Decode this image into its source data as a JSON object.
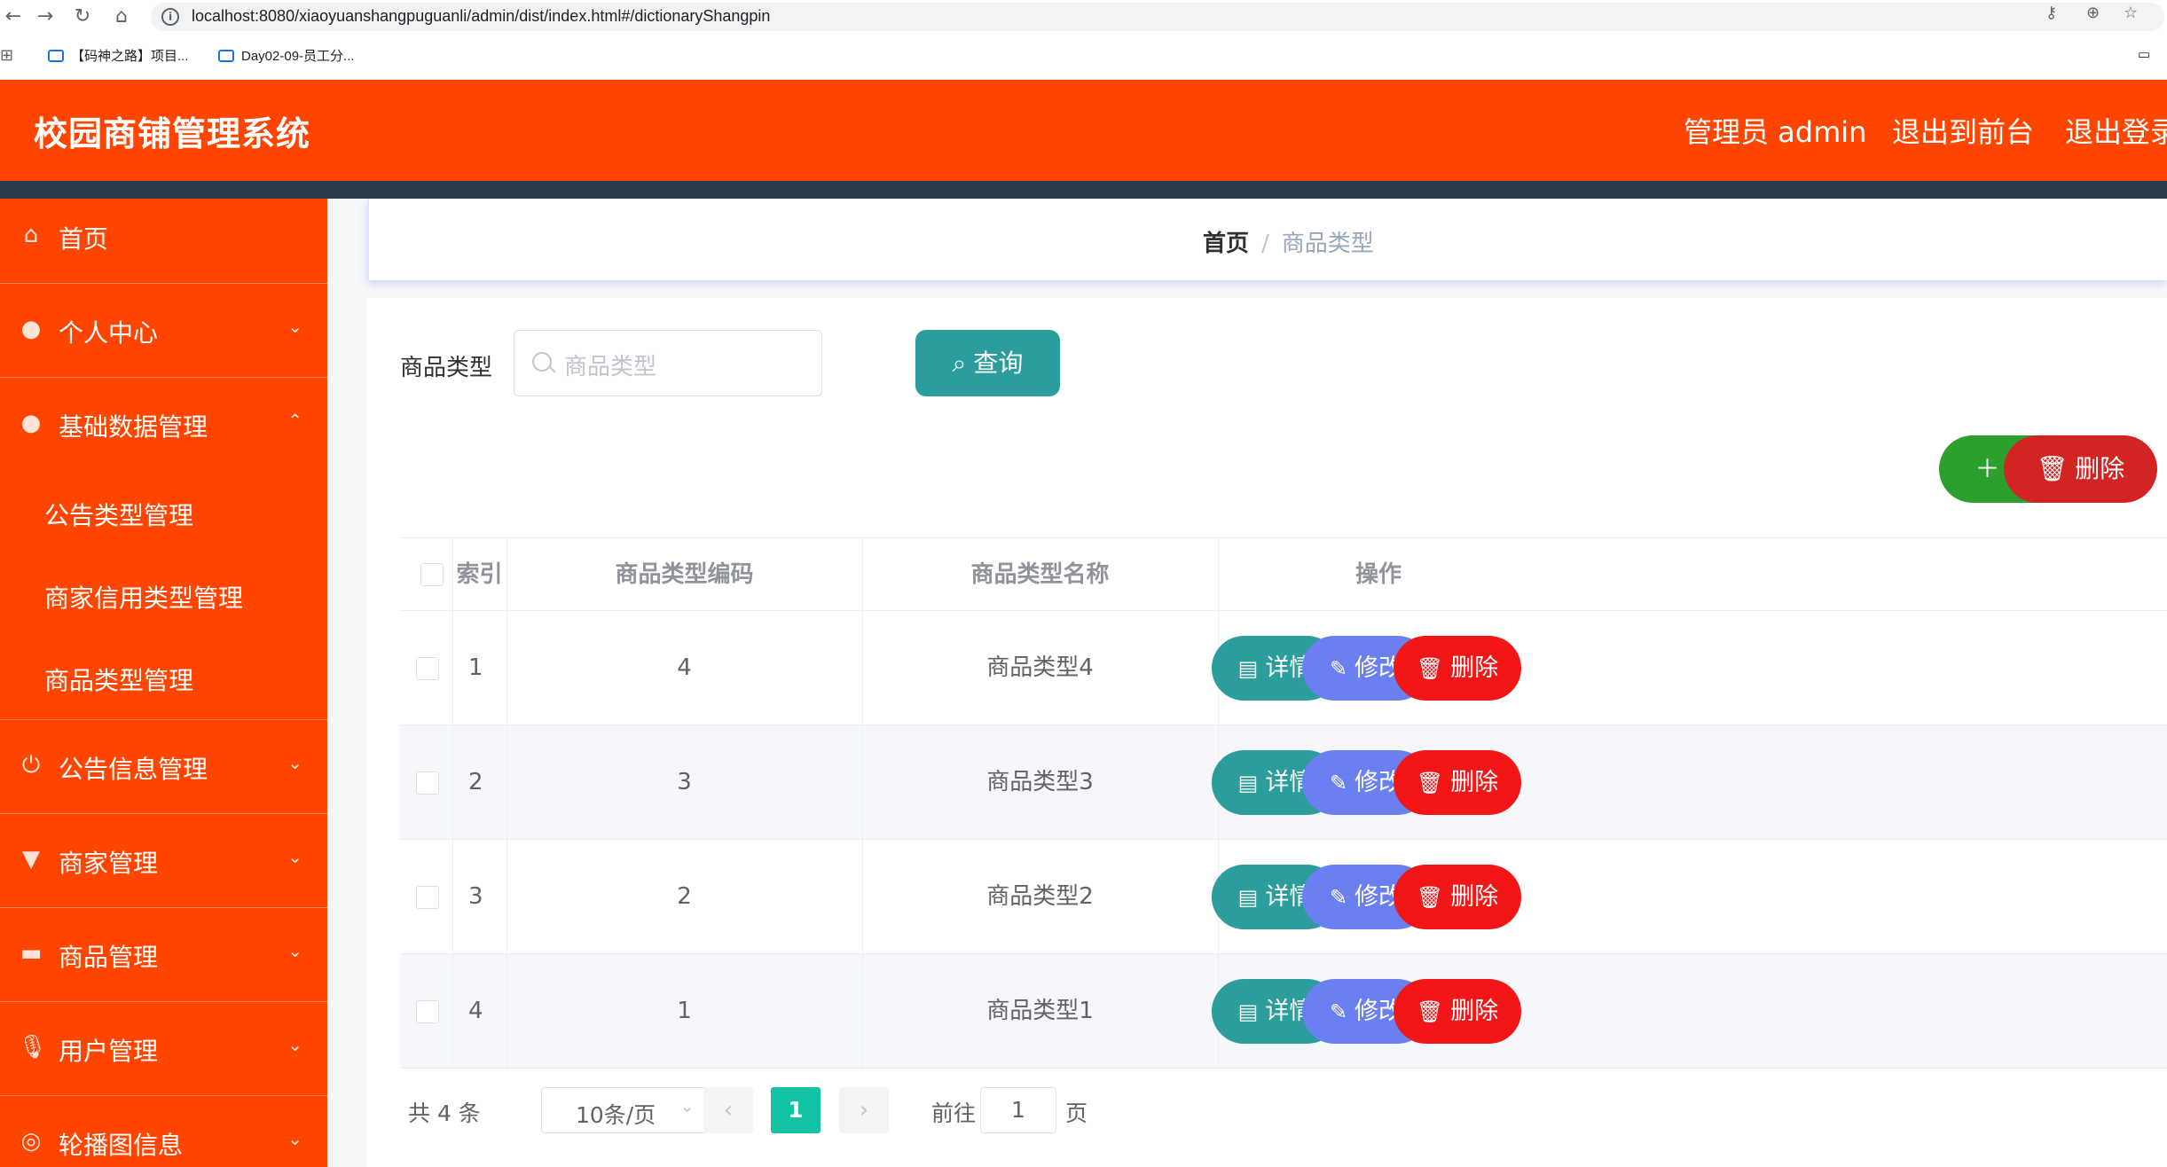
{
  "browser": {
    "url": "localhost:8080/xiaoyuanshangpuguanli/admin/dist/index.html#/dictionaryShangpin",
    "bookmarks": [
      "【码神之路】项目...",
      "Day02-09-员工分..."
    ]
  },
  "header": {
    "title": "校园商铺管理系统",
    "admin_label": "管理员 admin",
    "to_frontend": "退出到前台",
    "logout": "退出登录"
  },
  "sidebar": {
    "home": "首页",
    "personal_center": "个人中心",
    "basic_data": "基础数据管理",
    "sub_items": [
      "公告类型管理",
      "商家信用类型管理",
      "商品类型管理"
    ],
    "notice_info": "公告信息管理",
    "merchant": "商家管理",
    "goods": "商品管理",
    "user": "用户管理",
    "carousel": "轮播图信息"
  },
  "breadcrumb": {
    "home": "首页",
    "separator": "/",
    "current": "商品类型"
  },
  "search": {
    "label": "商品类型",
    "placeholder": "商品类型",
    "query_button": "查询"
  },
  "actions": {
    "add": "新增",
    "delete": "删除"
  },
  "table": {
    "columns": [
      "索引",
      "商品类型编码",
      "商品类型名称",
      "操作"
    ],
    "rows": [
      {
        "index": "1",
        "code": "4",
        "name": "商品类型4"
      },
      {
        "index": "2",
        "code": "3",
        "name": "商品类型3"
      },
      {
        "index": "3",
        "code": "2",
        "name": "商品类型2"
      },
      {
        "index": "4",
        "code": "1",
        "name": "商品类型1"
      }
    ],
    "row_actions": {
      "detail": "详情",
      "edit": "修改",
      "delete": "删除"
    }
  },
  "pagination": {
    "total": "共 4 条",
    "page_size": "10条/页",
    "current_page": "1",
    "goto_label": "前往",
    "goto_value": "1",
    "page_suffix": "页"
  },
  "colors": {
    "brand": "#ff4500",
    "header_strip": "#2d3a4b",
    "query": "#2a9d9c",
    "add": "#2ca02c",
    "danger": "#d32424",
    "edit": "#6a7ff0",
    "pager_active": "#13c2a3"
  }
}
